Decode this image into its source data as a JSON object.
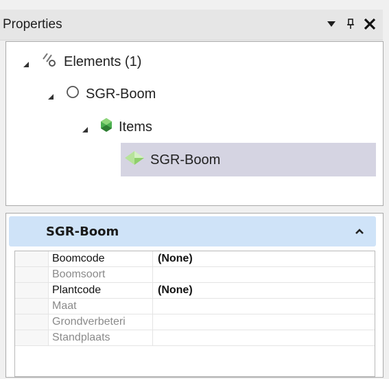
{
  "window": {
    "title": "Properties",
    "dropdown_icon": "chevron-down-icon",
    "pin_icon": "pin-icon",
    "close_icon": "close-icon"
  },
  "tree": {
    "root": {
      "label": "Elements (1)",
      "icon": "elements-link-icon"
    },
    "child": {
      "label": "SGR-Boom",
      "icon": "circle-outline-icon"
    },
    "items": {
      "label": "Items",
      "icon": "green-gem-icon"
    },
    "leaf": {
      "label": "SGR-Boom",
      "icon": "green-diamond-icon",
      "selected": true
    }
  },
  "properties": {
    "group_title": "SGR-Boom",
    "collapse_icon": "chevron-up-icon",
    "rows": [
      {
        "label": "Boomcode",
        "value": "(None)",
        "enabled": true
      },
      {
        "label": "Boomsoort",
        "value": "",
        "enabled": false
      },
      {
        "label": "Plantcode",
        "value": "(None)",
        "enabled": true
      },
      {
        "label": "Maat",
        "value": "",
        "enabled": false
      },
      {
        "label": "Grondverbeteri",
        "value": "",
        "enabled": false
      },
      {
        "label": "Standplaats",
        "value": "",
        "enabled": false
      }
    ]
  },
  "colors": {
    "selection": "#d5d4e2",
    "group_header": "#cfe3f8",
    "gem_green": "#4caf50"
  }
}
